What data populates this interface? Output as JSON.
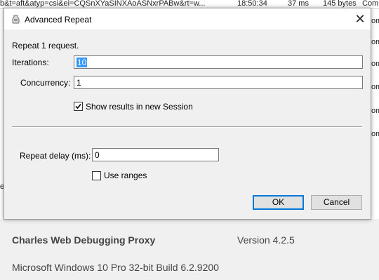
{
  "background": {
    "top_row": {
      "url_fragment": "b&t=aft&atyp=csi&ei=CQSnXYaSINXAoASNxrPABw&rt=w...",
      "time": "18:50:34",
      "duration": "37 ms",
      "size": "145 bytes",
      "status": "Com"
    },
    "right_fragments": [
      "om",
      "om",
      "om",
      "om",
      "om",
      "om"
    ],
    "left_fragments": [
      "e"
    ],
    "footer": {
      "product": "Charles Web Debugging Proxy",
      "version": "Version 4.2.5",
      "os": "Microsoft Windows 10 Pro 32-bit Build 6.2.9200"
    }
  },
  "dialog": {
    "title": "Advanced Repeat",
    "close_glyph": "✕",
    "summary": "Repeat 1 request.",
    "iterations": {
      "label": "Iterations:",
      "value": "10"
    },
    "concurrency": {
      "label": "Concurrency:",
      "value": "1"
    },
    "show_results": {
      "label": "Show results in new Session",
      "checked": true
    },
    "repeat_delay": {
      "label": "Repeat delay (ms):",
      "value": "0"
    },
    "use_ranges": {
      "label": "Use ranges",
      "checked": false
    },
    "buttons": {
      "ok": "OK",
      "cancel": "Cancel"
    },
    "colors": {
      "selection": "#3399ff",
      "default_button_border": "#0078d7"
    }
  }
}
